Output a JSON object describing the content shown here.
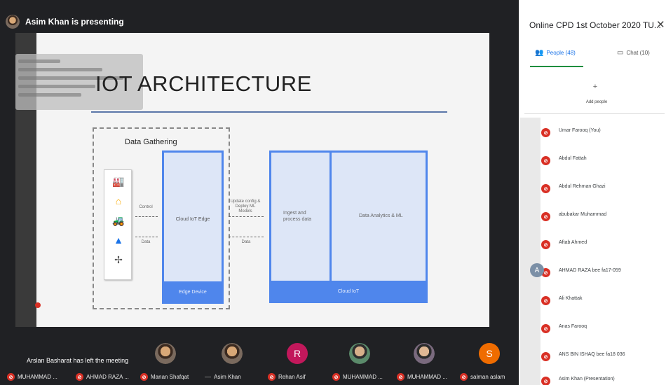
{
  "presenter": {
    "label": "Asim Khan is presenting"
  },
  "slide": {
    "title": "IOT ARCHITECTURE",
    "data_gathering": "Data Gathering",
    "edge_box_label": "Cloud IoT Edge",
    "edge_footer": "Edge Device",
    "control_label": "Control",
    "data_label_left": "Data",
    "update_label": "Update config & Deploy ML Models",
    "data_label_right": "Data",
    "ingest_label": "Ingest and process data",
    "analytics_label": "Data Analytics & ML",
    "cloud_footer": "Cloud IoT"
  },
  "bottom": {
    "notice": "Arslan Basharat has left the meeting",
    "participants": [
      "MUHAMMAD ...",
      "AHMAD RAZA ...",
      "Manan Shafqat",
      "Asim Khan",
      "Rehan Asif",
      "MUHAMMAD ...",
      "MUHAMMAD ...",
      "salman aslam"
    ],
    "tiles": {
      "rehan_initial": "R",
      "salman_initial": "S"
    }
  },
  "panel": {
    "title": "Online CPD 1st October 2020 TU...",
    "tab_people": "People (48)",
    "tab_chat": "Chat (10)",
    "add_people": "Add people",
    "people": [
      {
        "name": "Umar Farooq (You)"
      },
      {
        "name": "Abdul Fattah"
      },
      {
        "name": "Abdul Rehman Ghazi"
      },
      {
        "name": "abubakar Muhammad"
      },
      {
        "name": "Aftab Ahmed"
      },
      {
        "name": "AHMAD RAZA bee fa17-059"
      },
      {
        "name": "Ali Khattak"
      },
      {
        "name": "Anas Farooq"
      },
      {
        "name": "ANS BIN ISHAQ bee fa18 036"
      },
      {
        "name": "Asim Khan (Presentation)"
      }
    ]
  },
  "colors": {
    "accent_blue": "#4f86ec",
    "mic_red": "#d93025",
    "tab_green": "#1e8e3e"
  }
}
